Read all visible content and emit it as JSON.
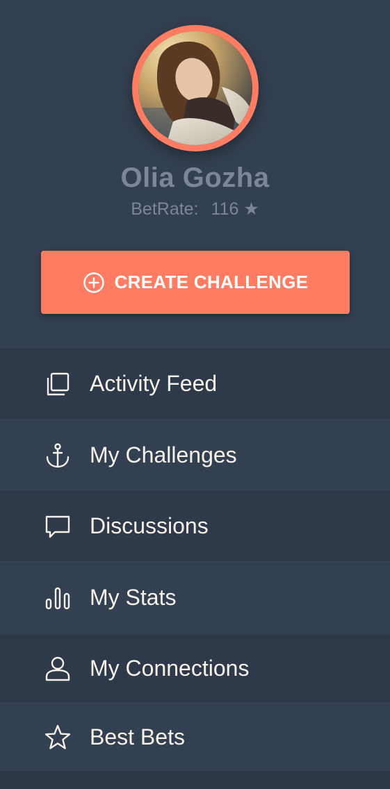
{
  "profile": {
    "name": "Olia Gozha",
    "betrate_label": "BetRate:",
    "betrate_value": "116 ★"
  },
  "create_button": {
    "label": "CREATE CHALLENGE",
    "icon": "plus-circle-icon"
  },
  "menu": {
    "items": [
      {
        "label": "Activity Feed",
        "icon": "copy-icon"
      },
      {
        "label": "My Challenges",
        "icon": "anchor-icon"
      },
      {
        "label": "Discussions",
        "icon": "chat-bubble-icon"
      },
      {
        "label": "My Stats",
        "icon": "bar-chart-icon"
      },
      {
        "label": "My Connections",
        "icon": "user-icon"
      },
      {
        "label": "Best Bets",
        "icon": "star-icon"
      }
    ]
  },
  "colors": {
    "background": "#334051",
    "accent": "#fe7c61",
    "menu_text": "#f6f2e9",
    "muted_text": "#7b8797"
  }
}
